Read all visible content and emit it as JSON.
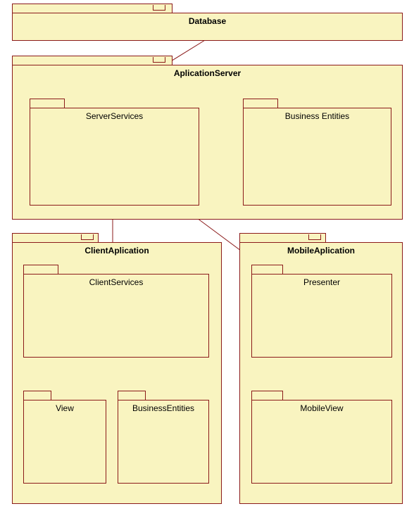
{
  "packages": {
    "database": {
      "label": "Database"
    },
    "applicationServer": {
      "label": "AplicationServer"
    },
    "serverServices": {
      "label": "ServerServices"
    },
    "businessEntities": {
      "label": "Business Entities"
    },
    "clientApplication": {
      "label": "ClientAplication"
    },
    "clientServices": {
      "label": "ClientServices"
    },
    "view": {
      "label": "View"
    },
    "businessEntities2": {
      "label": "BusinessEntities"
    },
    "mobileApplication": {
      "label": "MobileAplication"
    },
    "presenter": {
      "label": "Presenter"
    },
    "mobileView": {
      "label": "MobileView"
    }
  },
  "connections": [
    {
      "from": "Database",
      "to": "ServerServices"
    },
    {
      "from": "ServerServices",
      "to": "BusinessEntities"
    },
    {
      "from": "ServerServices",
      "to": "ClientServices"
    },
    {
      "from": "ServerServices",
      "to": "Presenter"
    },
    {
      "from": "ClientServices",
      "to": "View"
    },
    {
      "from": "ClientServices",
      "to": "BusinessEntities2"
    },
    {
      "from": "Presenter",
      "to": "MobileView"
    }
  ]
}
